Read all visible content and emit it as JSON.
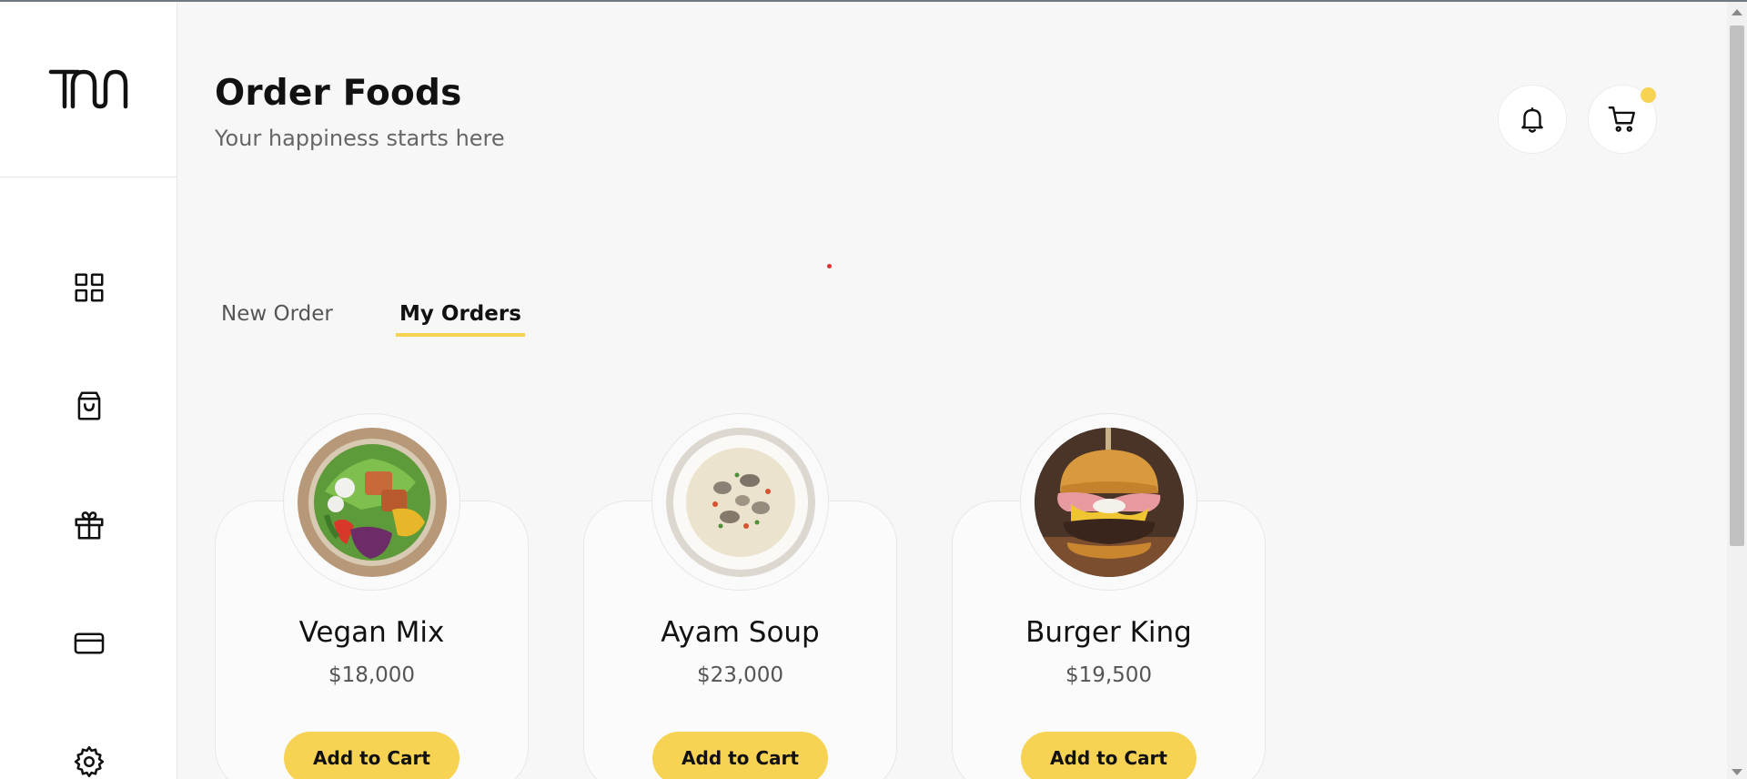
{
  "brand": {
    "logo_text": "TM"
  },
  "sidebar": {
    "items": [
      {
        "icon": "dashboard-icon"
      },
      {
        "icon": "shopping-bag-icon"
      },
      {
        "icon": "gift-icon"
      },
      {
        "icon": "credit-card-icon"
      },
      {
        "icon": "gear-icon"
      }
    ]
  },
  "header": {
    "title": "Order Foods",
    "subtitle": "Your happiness starts here",
    "notification_icon": "bell-icon",
    "cart_icon": "cart-icon"
  },
  "tabs": [
    {
      "label": "New Order",
      "active": false
    },
    {
      "label": "My Orders",
      "active": true
    }
  ],
  "foods": [
    {
      "name": "Vegan Mix",
      "price": "$18,000",
      "button": "Add to Cart"
    },
    {
      "name": "Ayam Soup",
      "price": "$23,000",
      "button": "Add to Cart"
    },
    {
      "name": "Burger King",
      "price": "$19,500",
      "button": "Add to Cart"
    }
  ],
  "colors": {
    "accent": "#f7d354",
    "background": "#f7f7f7",
    "sidebar": "#ffffff"
  }
}
